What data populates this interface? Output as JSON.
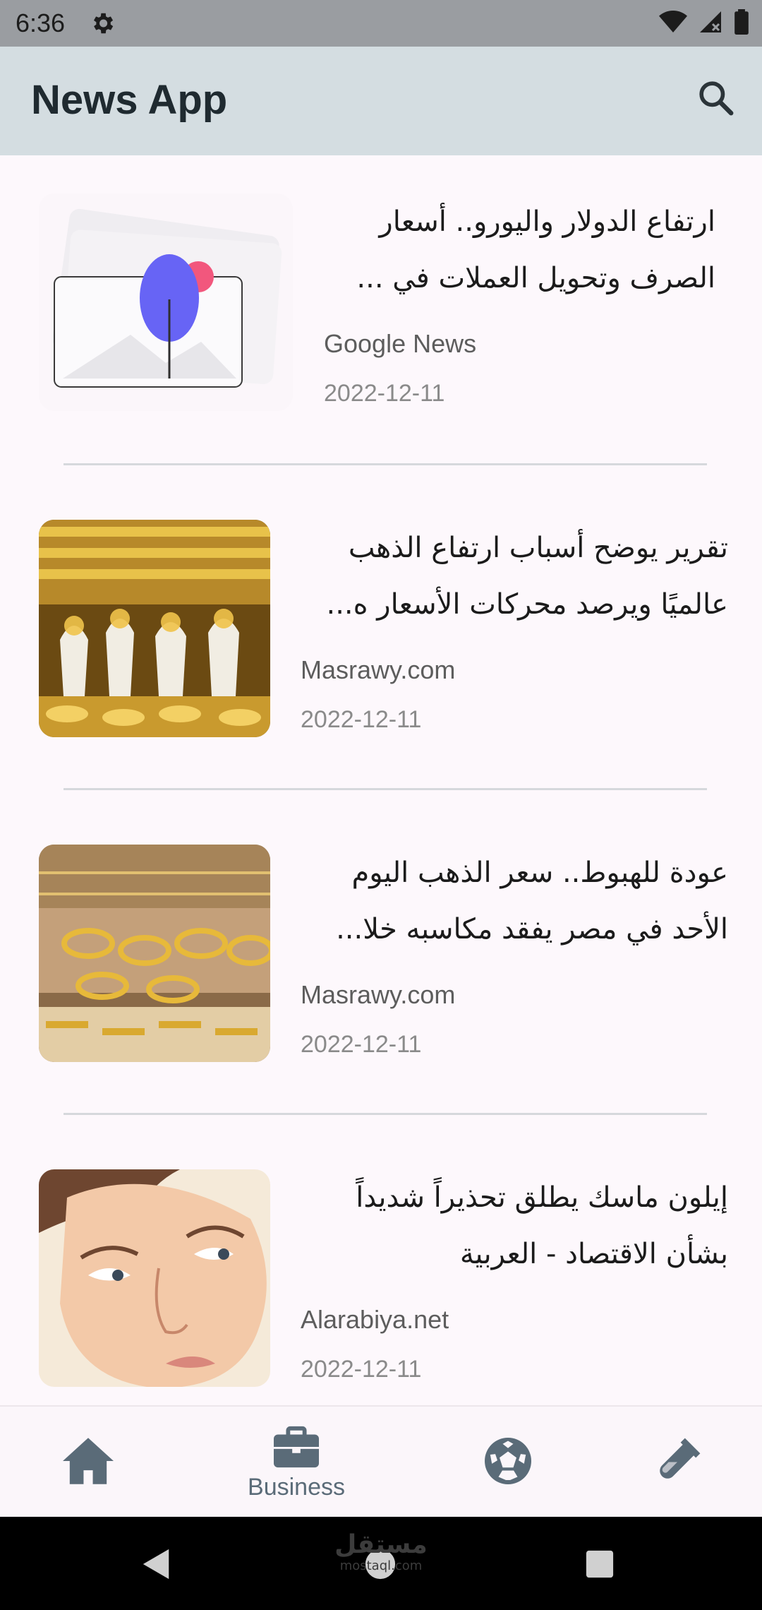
{
  "status_bar": {
    "time": "6:36"
  },
  "app_bar": {
    "title": "News App"
  },
  "articles": [
    {
      "headline": "ارتفاع الدولار واليورو.. أسعار الصرف وتحويل العملات في ...",
      "source": "Google News",
      "date": "2022-12-11",
      "thumbnail": "placeholder-image"
    },
    {
      "headline": "تقرير يوضح أسباب ارتفاع الذهب عالميًا ويرصد محركات الأسعار ه...",
      "source": "Masrawy.com",
      "date": "2022-12-11",
      "thumbnail": "gold-jewelry-photo"
    },
    {
      "headline": "عودة للهبوط.. سعر الذهب اليوم الأحد في مصر يفقد مكاسبه خلا...",
      "source": "Masrawy.com",
      "date": "2022-12-11",
      "thumbnail": "gold-bracelets-photo"
    },
    {
      "headline": "إيلون ماسك يطلق تحذيراً شديداً بشأن الاقتصاد - العربية",
      "source": "Alarabiya.net",
      "date": "2022-12-11",
      "thumbnail": "elon-musk-illustration"
    }
  ],
  "bottom_nav": {
    "items": [
      {
        "icon": "home-icon",
        "label": ""
      },
      {
        "icon": "briefcase-icon",
        "label": "Business",
        "selected": true
      },
      {
        "icon": "soccer-ball-icon",
        "label": ""
      },
      {
        "icon": "test-tube-icon",
        "label": ""
      }
    ]
  },
  "watermark": {
    "text": "مستقل",
    "subtext": "mostaql.com"
  },
  "colors": {
    "app_bar": "#d4dde1",
    "nav_icon": "#5a6b78",
    "status_bar": "#9a9da1"
  }
}
